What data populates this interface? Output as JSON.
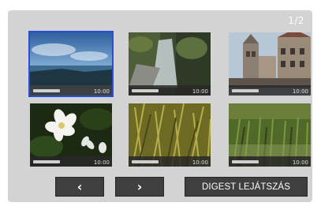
{
  "page_indicator": "1/2",
  "thumbnails": [
    {
      "time": "10:00",
      "selected": true,
      "icon": "seascape-thumbnail"
    },
    {
      "time": "10:00",
      "selected": false,
      "icon": "waterfall-thumbnail"
    },
    {
      "time": "10:00",
      "selected": false,
      "icon": "buildings-thumbnail"
    },
    {
      "time": "10:00",
      "selected": false,
      "icon": "flower-thumbnail"
    },
    {
      "time": "10:00",
      "selected": false,
      "icon": "grass-thumbnail"
    },
    {
      "time": "10:00",
      "selected": false,
      "icon": "field-thumbnail"
    }
  ],
  "buttons": {
    "prev": "‹",
    "next": "›",
    "digest": "DIGEST LEJÁTSZÁS"
  },
  "colors": {
    "panel": "#d3d3d3",
    "selection": "#2a4fd6",
    "button": "#3f3f3f"
  }
}
